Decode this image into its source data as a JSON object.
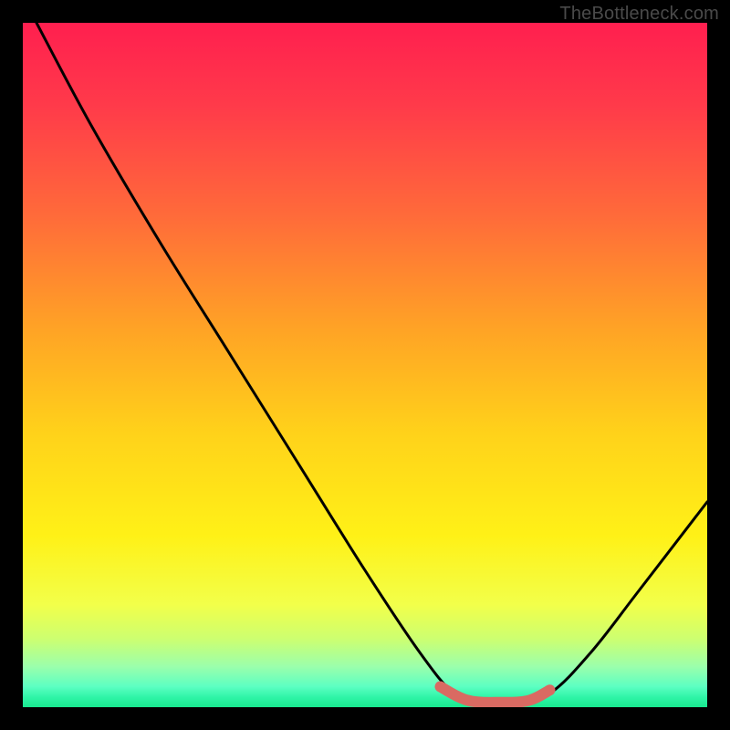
{
  "watermark": {
    "text": "TheBottleneck.com"
  },
  "colors": {
    "frame_bg": "#000000",
    "gradient_stops": [
      {
        "offset": 0.0,
        "color": "#ff1f4f"
      },
      {
        "offset": 0.12,
        "color": "#ff3a4a"
      },
      {
        "offset": 0.28,
        "color": "#ff6a3a"
      },
      {
        "offset": 0.45,
        "color": "#ffa425"
      },
      {
        "offset": 0.6,
        "color": "#ffd21a"
      },
      {
        "offset": 0.75,
        "color": "#fff117"
      },
      {
        "offset": 0.85,
        "color": "#f2ff4a"
      },
      {
        "offset": 0.9,
        "color": "#cdff70"
      },
      {
        "offset": 0.94,
        "color": "#9cffab"
      },
      {
        "offset": 0.97,
        "color": "#5cffc2"
      },
      {
        "offset": 0.985,
        "color": "#30f5a8"
      },
      {
        "offset": 1.0,
        "color": "#18e88f"
      }
    ],
    "curve_stroke": "#000000",
    "segment_stroke": "#d96a62"
  },
  "chart_data": {
    "type": "line",
    "title": "",
    "xlabel": "",
    "ylabel": "",
    "xlim": [
      0,
      100
    ],
    "ylim": [
      0,
      100
    ],
    "series": [
      {
        "name": "bottleneck-curve",
        "points": [
          {
            "x": 2,
            "y": 100
          },
          {
            "x": 10,
            "y": 85
          },
          {
            "x": 20,
            "y": 68
          },
          {
            "x": 30,
            "y": 52
          },
          {
            "x": 40,
            "y": 36
          },
          {
            "x": 50,
            "y": 20
          },
          {
            "x": 58,
            "y": 8
          },
          {
            "x": 63,
            "y": 2
          },
          {
            "x": 67,
            "y": 0.5
          },
          {
            "x": 72,
            "y": 0.5
          },
          {
            "x": 77,
            "y": 2
          },
          {
            "x": 83,
            "y": 8
          },
          {
            "x": 90,
            "y": 17
          },
          {
            "x": 100,
            "y": 30
          }
        ]
      },
      {
        "name": "highlight-segment",
        "points": [
          {
            "x": 61,
            "y": 3
          },
          {
            "x": 65,
            "y": 1
          },
          {
            "x": 70,
            "y": 0.7
          },
          {
            "x": 74,
            "y": 1
          },
          {
            "x": 77,
            "y": 2.5
          }
        ]
      }
    ]
  }
}
